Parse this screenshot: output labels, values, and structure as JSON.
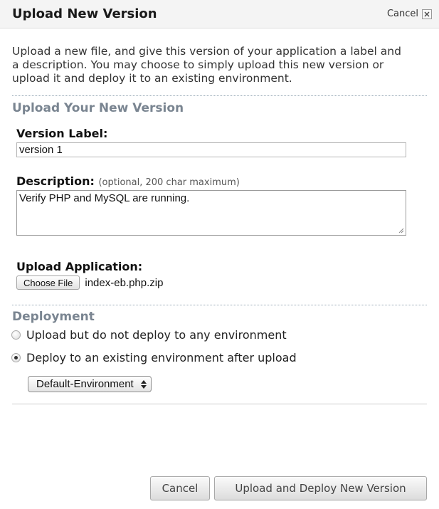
{
  "dialog": {
    "title": "Upload New Version",
    "cancel_link": "Cancel",
    "intro": "Upload a new file, and give this version of your application a label and a description. You may choose to simply upload this new version or upload it and deploy it to an existing environment."
  },
  "upload_section": {
    "heading": "Upload Your New Version",
    "version_label": {
      "label": "Version Label:",
      "value": "version 1"
    },
    "description": {
      "label": "Description:",
      "hint": "(optional, 200 char maximum)",
      "value": "Verify PHP and MySQL are running."
    },
    "upload_application": {
      "label": "Upload Application:",
      "button": "Choose File",
      "file_name": "index-eb.php.zip"
    }
  },
  "deployment": {
    "heading": "Deployment",
    "options": [
      {
        "label": "Upload but do not deploy to any environment",
        "selected": false
      },
      {
        "label": "Deploy to an existing environment after upload",
        "selected": true
      }
    ],
    "environment_select": {
      "selected": "Default-Environment"
    }
  },
  "footer": {
    "cancel_button": "Cancel",
    "submit_button": "Upload and Deploy New Version"
  },
  "colors": {
    "section_heading": "#7a8591",
    "titlebar_bg": "#f4f4f4",
    "divider_dotted": "#9aaab8"
  }
}
